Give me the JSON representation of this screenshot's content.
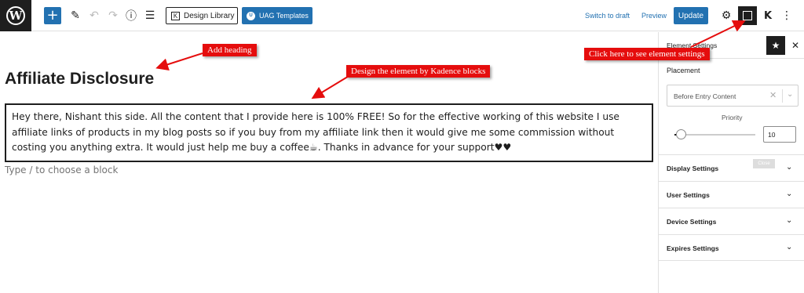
{
  "toolbar": {
    "design_library_label": "Design Library",
    "uag_templates_label": "UAG Templates",
    "switch_to_draft_label": "Switch to draft",
    "preview_label": "Preview",
    "update_label": "Update",
    "add_block_icon": "plus-icon",
    "edit_icon": "pencil-icon",
    "undo_icon": "undo-icon",
    "redo_icon": "redo-icon",
    "info_icon": "info-icon",
    "outline_icon": "list-view-icon",
    "settings_icon": "gear-icon",
    "accent_color": "#2271b1"
  },
  "editor": {
    "title": "Affiliate Disclosure",
    "paragraph": "Hey there, Nishant this side. All the content that I provide here is 100% FREE! So for the effective working of this website I use affiliate links of products in my blog posts so if you buy from my affiliate link then it would give me some commission without costing you anything extra. It would just help me buy a coffee☕. Thanks in advance for your support♥♥",
    "block_placeholder": "Type / to choose a block"
  },
  "sidebar": {
    "title": "Element Settings",
    "placement_label": "Placement",
    "placement_value": "Before Entry Content",
    "priority_label": "Priority",
    "priority_value": "10",
    "priority_slider_fraction": 0.08,
    "tooltip_text": "Close",
    "sections": [
      {
        "label": "Display Settings"
      },
      {
        "label": "User Settings"
      },
      {
        "label": "Device Settings"
      },
      {
        "label": "Expires Settings"
      }
    ]
  },
  "annotations": {
    "add_heading": "Add heading",
    "design_element": "Design the element by Kadence blocks",
    "click_here": "Click here to see element settings",
    "color": "#e50d0d"
  }
}
